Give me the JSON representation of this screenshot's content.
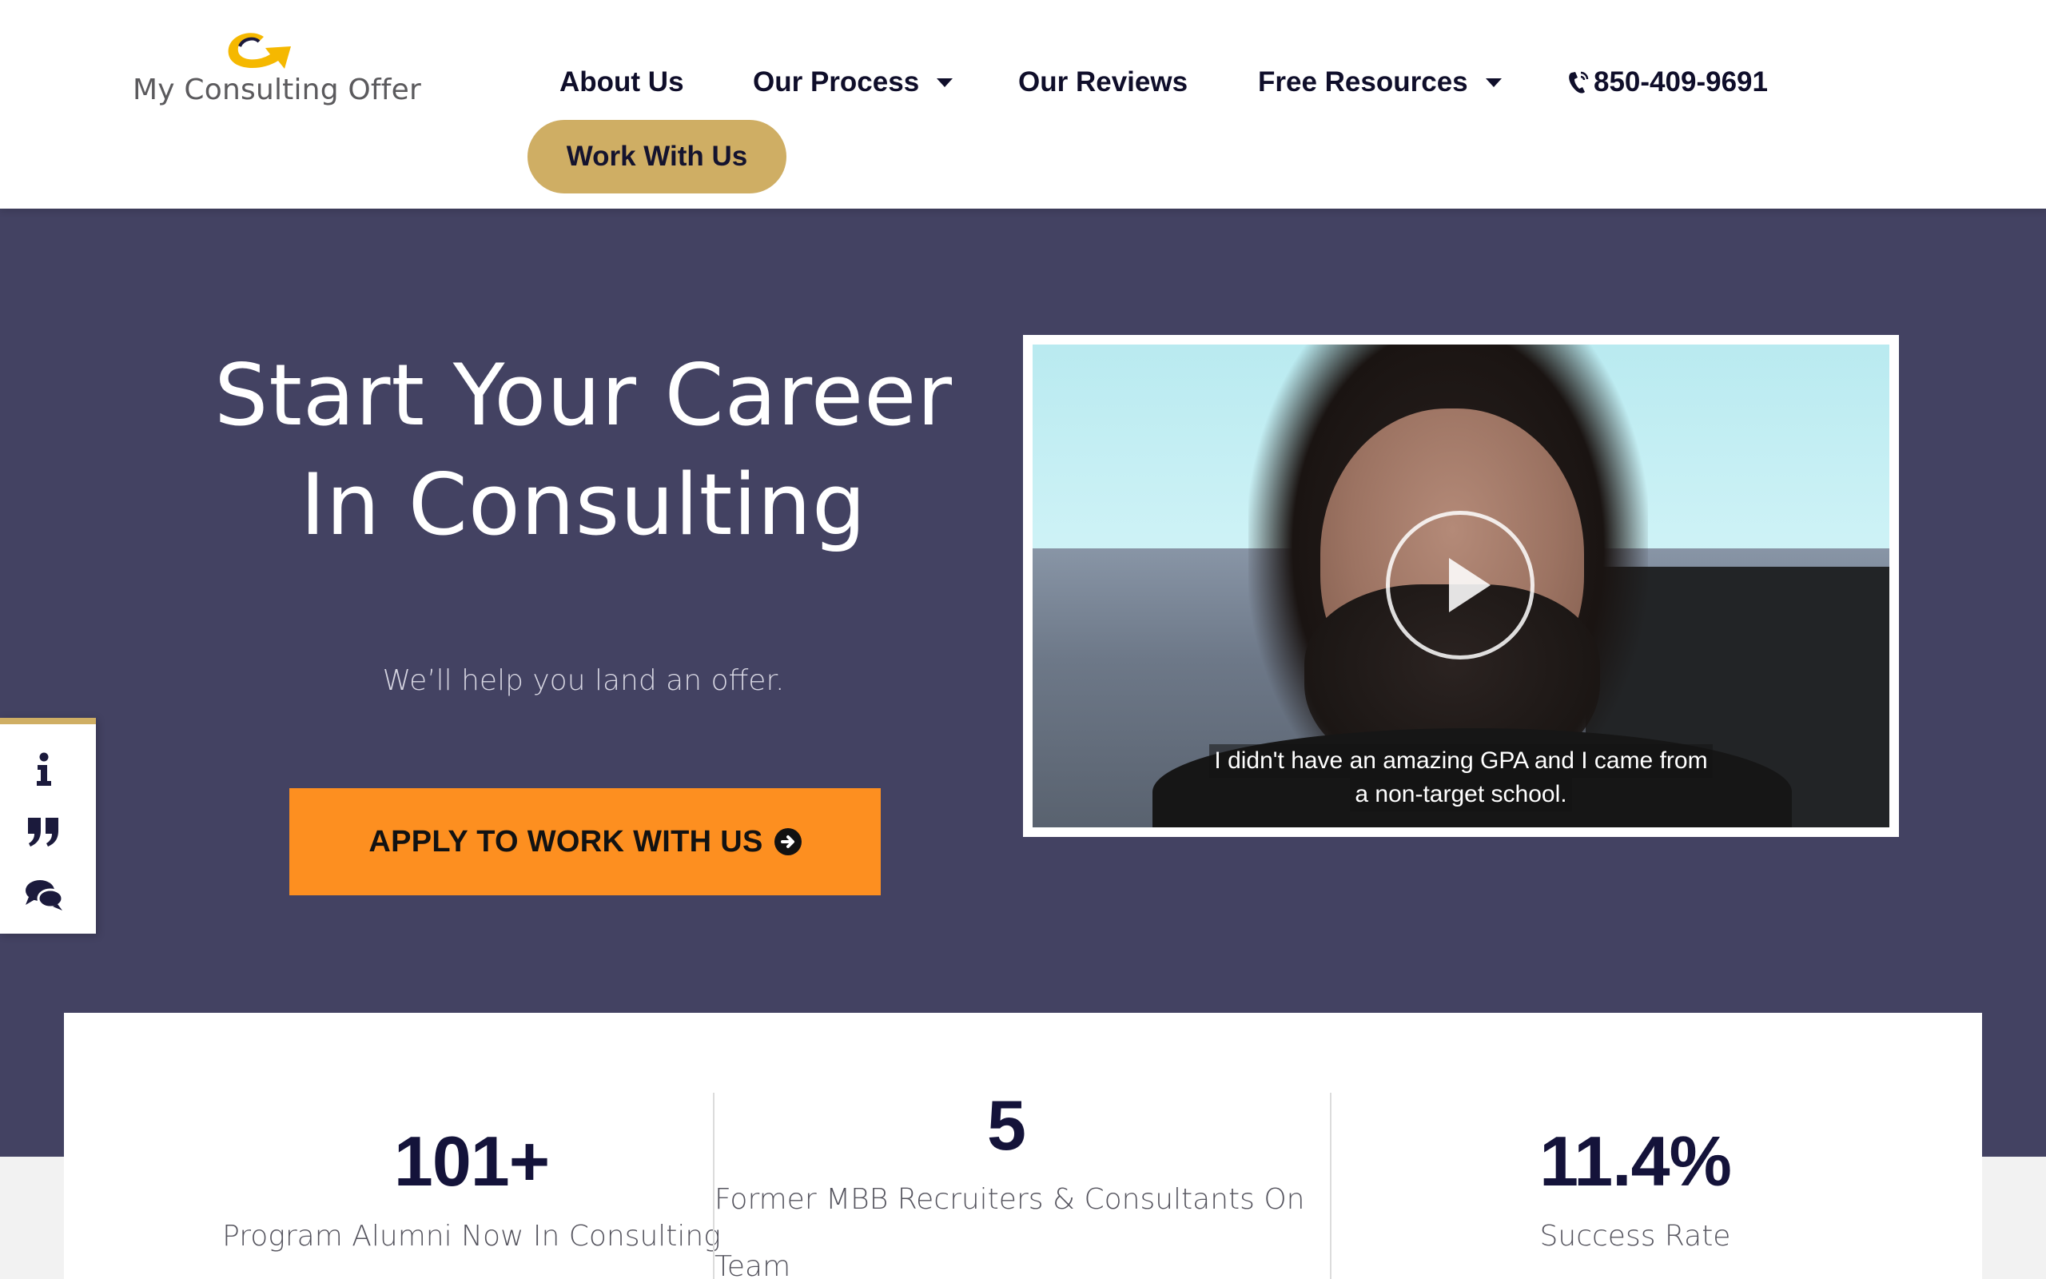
{
  "header": {
    "logo_text": "My Consulting Offer",
    "nav": {
      "about": "About Us",
      "process": "Our Process",
      "reviews": "Our Reviews",
      "resources": "Free Resources",
      "phone": "850-409-9691"
    },
    "work_button": "Work With Us"
  },
  "hero": {
    "title_line1": "Start Your Career",
    "title_line2": "In Consulting",
    "subtitle": "We’ll help you land an offer.",
    "apply_button": "APPLY TO WORK WITH US",
    "video": {
      "caption_line1": "I didn't have an amazing GPA and I came from",
      "caption_line2": "a non-target school."
    }
  },
  "side_tabs": {
    "icons": [
      "info-icon",
      "quote-icon",
      "chat-icon"
    ]
  },
  "stats": [
    {
      "value": "101+",
      "label": "Program Alumni Now In Consulting"
    },
    {
      "value": "5",
      "label_line1": "Former MBB Recruiters & Consultants On",
      "label_line2": "Team"
    },
    {
      "value": "11.4%",
      "label": "Success Rate"
    }
  ],
  "colors": {
    "hero_bg": "#434262",
    "accent_gold": "#cfae64",
    "cta_orange": "#fd8f20",
    "logo_yellow": "#f5b800",
    "navy_text": "#14133a"
  }
}
